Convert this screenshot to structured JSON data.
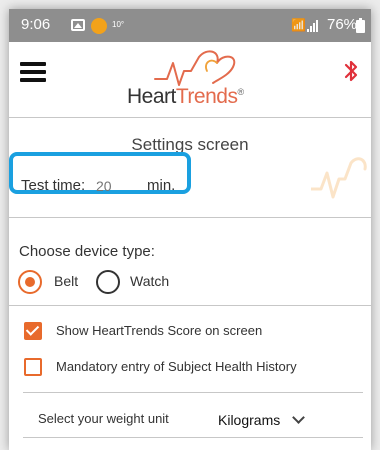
{
  "status_bar": {
    "time": "9:06",
    "small_text": "10°",
    "battery_pct": "76%",
    "icons": [
      "gallery-icon",
      "app-notification-icon",
      "wifi-icon",
      "signal-icon",
      "battery-icon"
    ]
  },
  "header": {
    "logo_part1": "Heart",
    "logo_part2": "Trends",
    "logo_reg": "®",
    "menu_icon": "hamburger-menu-icon",
    "bluetooth_icon": "bluetooth-icon"
  },
  "settings": {
    "title": "Settings screen",
    "test_time_label": "Test time:",
    "test_time_placeholder": "20",
    "test_time_unit": "min."
  },
  "device": {
    "title": "Choose device type:",
    "options": [
      {
        "label": "Belt",
        "selected": true
      },
      {
        "label": "Watch",
        "selected": false
      }
    ]
  },
  "options": [
    {
      "label": "Show HeartTrends Score on screen",
      "checked": true
    },
    {
      "label": "Mandatory entry of Subject Health History",
      "checked": false
    }
  ],
  "weight": {
    "label": "Select your weight unit",
    "value": "Kilograms"
  },
  "colors": {
    "accent": "#e86a2c",
    "highlight": "#1aa0e0",
    "status_bar": "#8e8e8e",
    "bluetooth": "#e0303a"
  }
}
